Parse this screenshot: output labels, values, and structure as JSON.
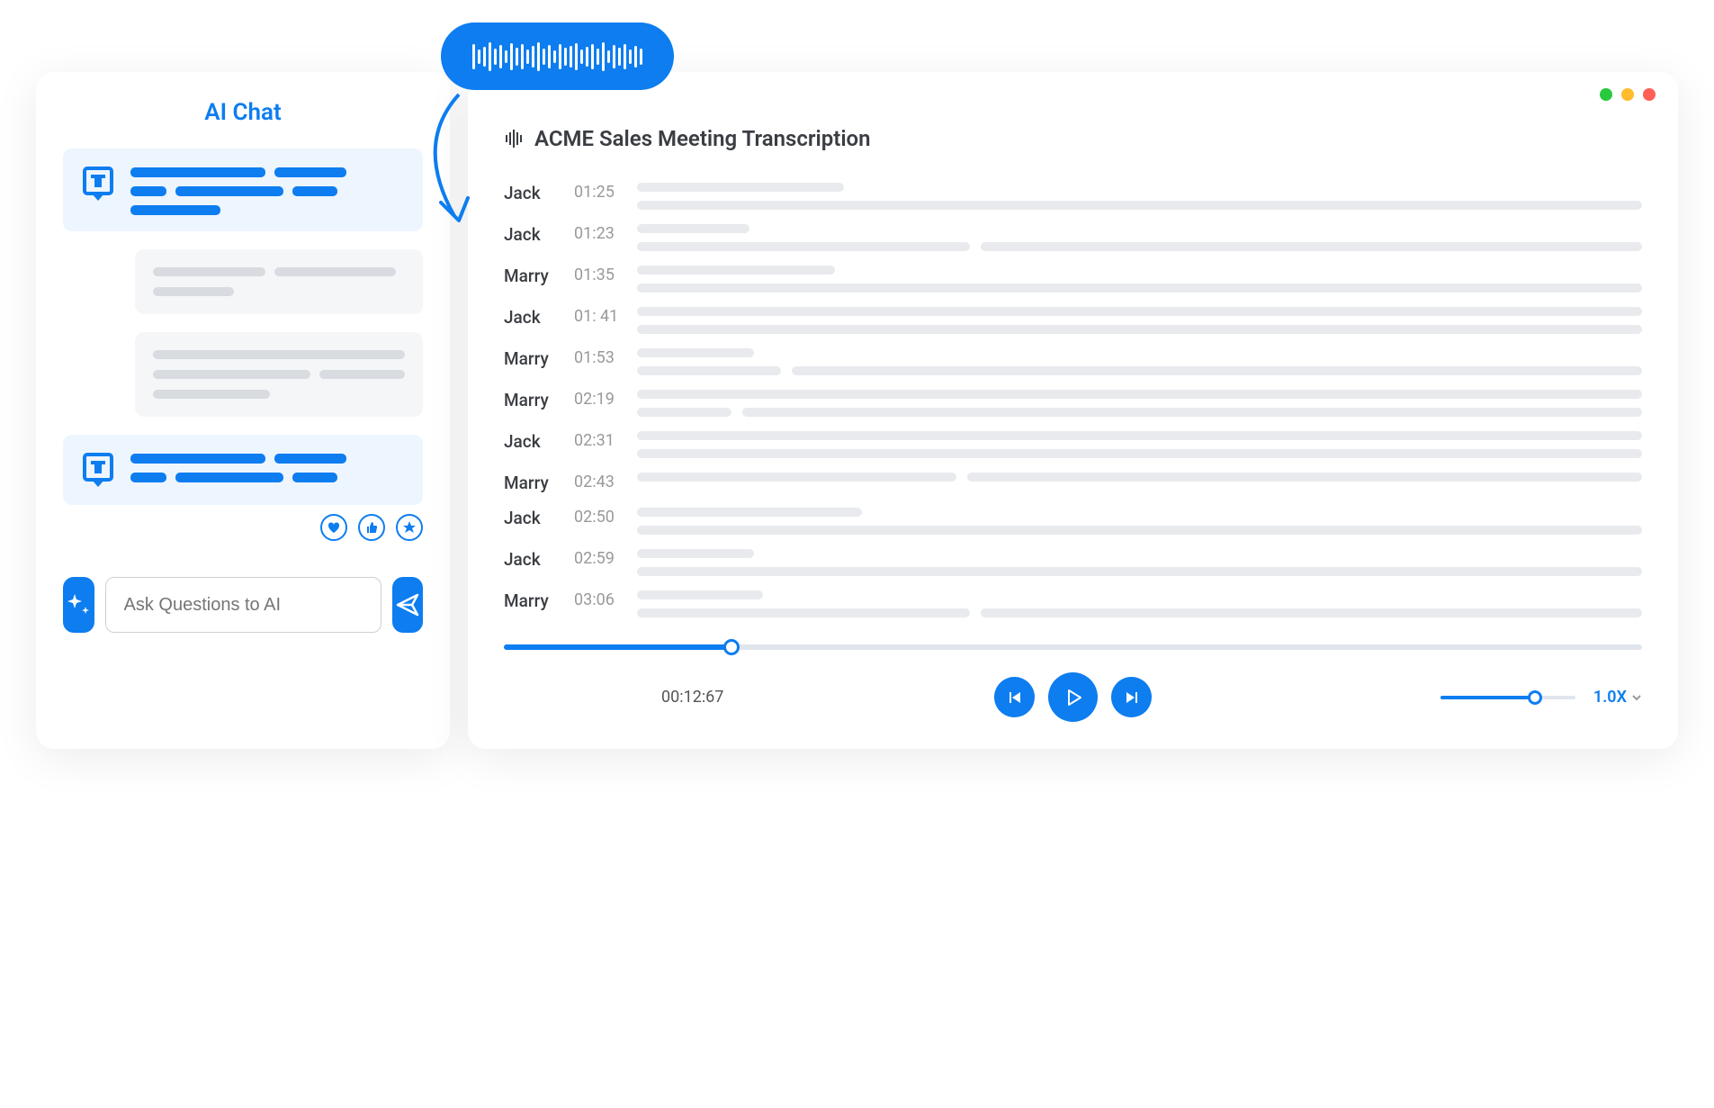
{
  "chat": {
    "title": "AI Chat",
    "input_placeholder": "Ask Questions to AI"
  },
  "transcription": {
    "title": "ACME Sales Meeting Transcription",
    "rows": [
      {
        "speaker": "Jack",
        "time": "01:25"
      },
      {
        "speaker": "Jack",
        "time": "01:23"
      },
      {
        "speaker": "Marry",
        "time": "01:35"
      },
      {
        "speaker": "Jack",
        "time": "01: 41"
      },
      {
        "speaker": "Marry",
        "time": "01:53"
      },
      {
        "speaker": "Marry",
        "time": "02:19"
      },
      {
        "speaker": "Jack",
        "time": "02:31"
      },
      {
        "speaker": "Marry",
        "time": "02:43"
      },
      {
        "speaker": "Jack",
        "time": "02:50"
      },
      {
        "speaker": "Jack",
        "time": "02:59"
      },
      {
        "speaker": "Marry",
        "time": "03:06"
      }
    ]
  },
  "player": {
    "time": "00:12:67",
    "speed": "1.0X"
  },
  "window_colors": {
    "green": "#27c93f",
    "yellow": "#febc2e",
    "red": "#ff5f56"
  }
}
